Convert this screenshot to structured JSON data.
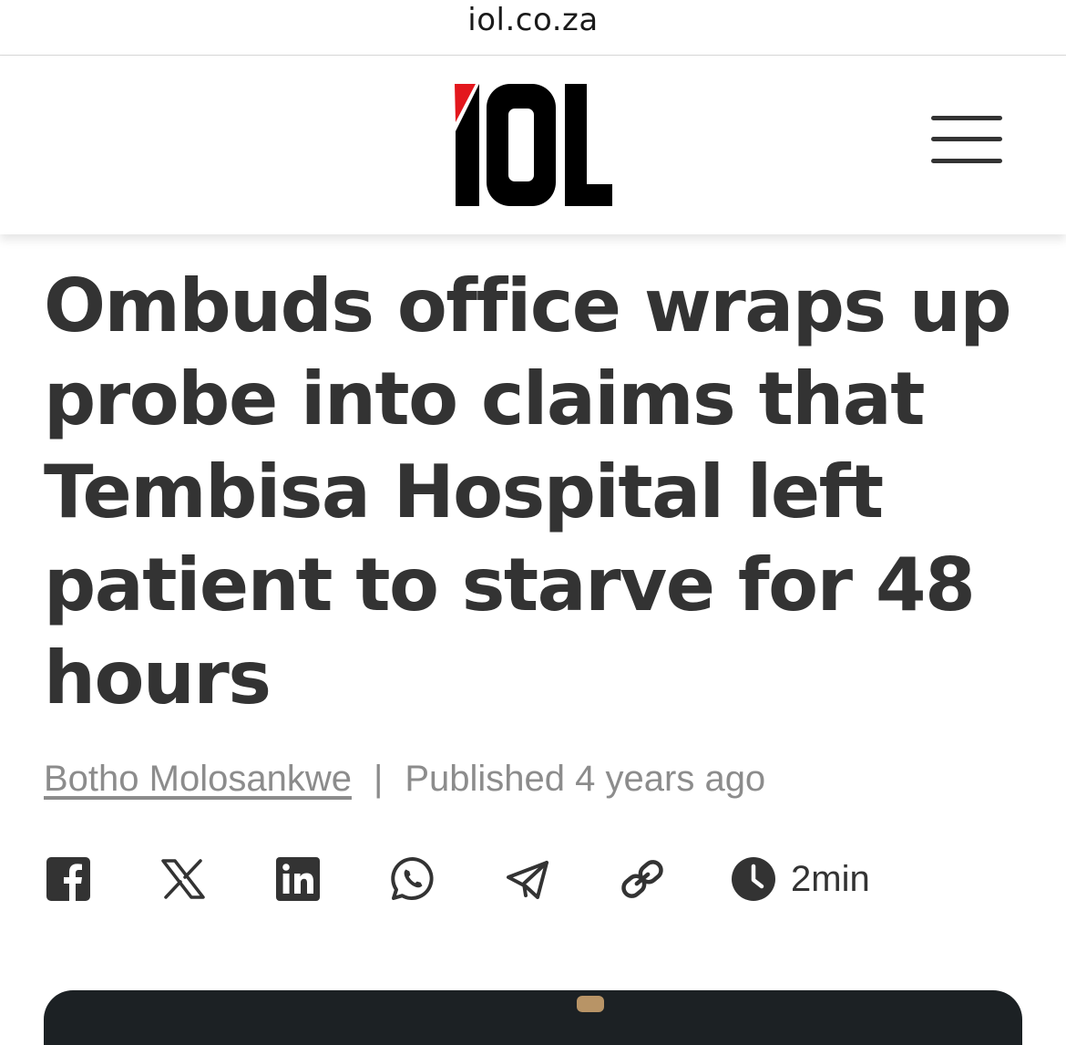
{
  "browser": {
    "url": "iol.co.za"
  },
  "header": {
    "logo_text": "IOL",
    "brand_color": "#e3171d"
  },
  "article": {
    "headline": "Ombuds office wraps up probe into claims that Tembisa Hospital left patient to starve for 48 hours",
    "author": "Botho Molosankwe",
    "separator": "|",
    "published": "Published 4 years ago",
    "read_time": "2min"
  },
  "share": [
    "facebook-icon",
    "x-icon",
    "linkedin-icon",
    "whatsapp-icon",
    "telegram-icon",
    "link-icon"
  ],
  "colors": {
    "text": "#333333",
    "meta": "#8c8c8c",
    "accent": "#e3171d"
  }
}
